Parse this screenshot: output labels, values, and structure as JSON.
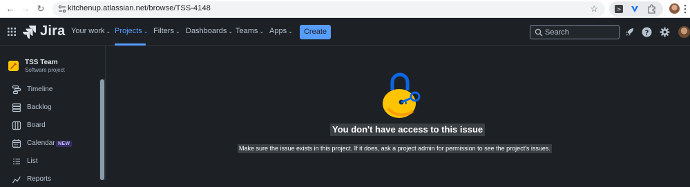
{
  "browser": {
    "url": "kitchenup.atlassian.net/browse/TSS-4148"
  },
  "topnav": {
    "logo_text": "Jira",
    "items": [
      {
        "label": "Your work"
      },
      {
        "label": "Projects"
      },
      {
        "label": "Filters"
      },
      {
        "label": "Dashboards"
      },
      {
        "label": "Teams"
      },
      {
        "label": "Apps"
      }
    ],
    "create_label": "Create",
    "search_placeholder": "Search"
  },
  "sidebar": {
    "project_name": "TSS Team",
    "project_type": "Software project",
    "items": [
      {
        "label": "Timeline",
        "icon": "timeline-icon"
      },
      {
        "label": "Backlog",
        "icon": "backlog-icon"
      },
      {
        "label": "Board",
        "icon": "board-icon"
      },
      {
        "label": "Calendar",
        "icon": "calendar-icon",
        "badge": "NEW"
      },
      {
        "label": "List",
        "icon": "list-icon"
      },
      {
        "label": "Reports",
        "icon": "reports-icon"
      }
    ]
  },
  "main": {
    "heading": "You don't have access to this issue",
    "message": "Make sure the issue exists in this project. If it does, ask a project admin for permission to see the project's issues."
  },
  "colors": {
    "background": "#1d2125",
    "accent": "#579dff",
    "lock_body": "#ffc400",
    "lock_shackle": "#0c66e4"
  }
}
